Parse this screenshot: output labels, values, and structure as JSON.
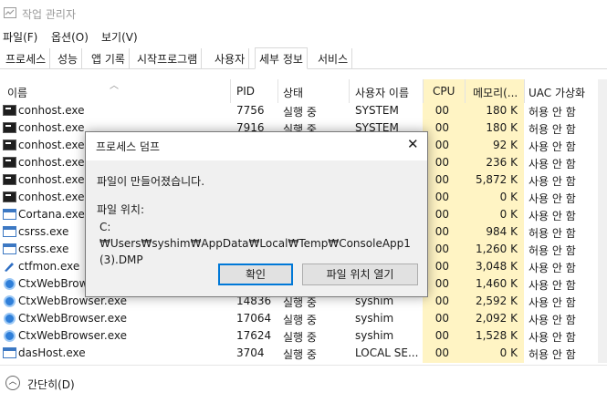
{
  "window": {
    "title": "작업 관리자"
  },
  "menu": [
    "파일(F)",
    "옵션(O)",
    "보기(V)"
  ],
  "tabs": [
    "프로세스",
    "성능",
    "앱 기록",
    "시작프로그램",
    "사용자",
    "세부 정보",
    "서비스"
  ],
  "active_tab": "세부 정보",
  "columns": {
    "name": "이름",
    "pid": "PID",
    "status": "상태",
    "user": "사용자 이름",
    "cpu": "CPU",
    "mem": "메모리(...",
    "uac": "UAC 가상화"
  },
  "rows": [
    {
      "icon": "console-icon",
      "name": "conhost.exe",
      "pid": "7756",
      "status": "실행 중",
      "user": "SYSTEM",
      "cpu": "00",
      "mem": "180 K",
      "uac": "허용 안 함"
    },
    {
      "icon": "console-icon",
      "name": "conhost.exe",
      "pid": "7916",
      "status": "실행 중",
      "user": "SYSTEM",
      "cpu": "00",
      "mem": "180 K",
      "uac": "허용 안 함"
    },
    {
      "icon": "console-icon",
      "name": "conhost.exe",
      "pid": "",
      "status": "",
      "user": "",
      "cpu": "00",
      "mem": "92 K",
      "uac": "사용 안 함"
    },
    {
      "icon": "console-icon",
      "name": "conhost.exe",
      "pid": "",
      "status": "",
      "user": "",
      "cpu": "00",
      "mem": "236 K",
      "uac": "사용 안 함"
    },
    {
      "icon": "console-icon",
      "name": "conhost.exe",
      "pid": "",
      "status": "",
      "user": "",
      "cpu": "00",
      "mem": "5,872 K",
      "uac": "사용 안 함"
    },
    {
      "icon": "console-icon",
      "name": "conhost.exe",
      "pid": "",
      "status": "",
      "user": "",
      "cpu": "00",
      "mem": "0 K",
      "uac": "사용 안 함"
    },
    {
      "icon": "window-icon",
      "name": "Cortana.exe",
      "pid": "",
      "status": "",
      "user": "",
      "cpu": "00",
      "mem": "0 K",
      "uac": "사용 안 함"
    },
    {
      "icon": "window-icon",
      "name": "csrss.exe",
      "pid": "",
      "status": "",
      "user": "",
      "cpu": "00",
      "mem": "984 K",
      "uac": "허용 안 함"
    },
    {
      "icon": "window-icon",
      "name": "csrss.exe",
      "pid": "",
      "status": "",
      "user": "",
      "cpu": "00",
      "mem": "1,260 K",
      "uac": "허용 안 함"
    },
    {
      "icon": "pen-icon",
      "name": "ctfmon.exe",
      "pid": "",
      "status": "",
      "user": "",
      "cpu": "00",
      "mem": "3,048 K",
      "uac": "사용 안 함"
    },
    {
      "icon": "globe-icon",
      "name": "CtxWebBrows",
      "pid": "",
      "status": "",
      "user": "",
      "cpu": "00",
      "mem": "1,460 K",
      "uac": "사용 안 함"
    },
    {
      "icon": "globe-icon",
      "name": "CtxWebBrowser.exe",
      "pid": "14836",
      "status": "실행 중",
      "user": "syshim",
      "cpu": "00",
      "mem": "2,592 K",
      "uac": "사용 안 함"
    },
    {
      "icon": "globe-icon",
      "name": "CtxWebBrowser.exe",
      "pid": "17064",
      "status": "실행 중",
      "user": "syshim",
      "cpu": "00",
      "mem": "2,092 K",
      "uac": "사용 안 함"
    },
    {
      "icon": "globe-icon",
      "name": "CtxWebBrowser.exe",
      "pid": "17624",
      "status": "실행 중",
      "user": "syshim",
      "cpu": "00",
      "mem": "1,528 K",
      "uac": "사용 안 함"
    },
    {
      "icon": "window-icon",
      "name": "dasHost.exe",
      "pid": "3704",
      "status": "실행 중",
      "user": "LOCAL SE...",
      "cpu": "00",
      "mem": "0 K",
      "uac": "허용 안 함"
    }
  ],
  "footer": {
    "fewer_label": "간단히(D)"
  },
  "dialog": {
    "title": "프로세스 덤프",
    "message": "파일이 만들어졌습니다.",
    "location_label": "파일 위치:",
    "path": "C:₩Users₩syshim₩AppData₩Local₩Temp₩ConsoleApp1 (3).DMP",
    "ok_label": "확인",
    "open_location_label": "파일 위치 열기"
  }
}
